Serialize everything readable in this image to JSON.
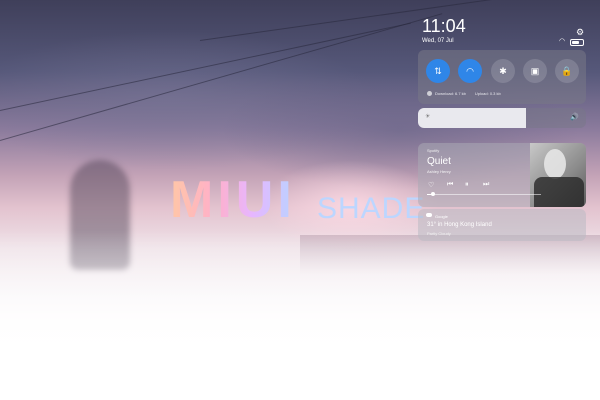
{
  "logo": {
    "primary": "MIUI",
    "secondary": "SHADE"
  },
  "status": {
    "time": "11:04",
    "date": "Wed, 07 Jul",
    "settings_icon": "gear-icon",
    "wifi_icon": "wifi-icon",
    "battery_icon": "battery-icon"
  },
  "toggles": [
    {
      "name": "data-toggle",
      "icon": "⇅",
      "on": true
    },
    {
      "name": "wifi-toggle",
      "icon": "◠",
      "on": true
    },
    {
      "name": "bluetooth-toggle",
      "icon": "✱",
      "on": false
    },
    {
      "name": "screenshot-toggle",
      "icon": "▣",
      "on": false
    },
    {
      "name": "lock-toggle",
      "icon": "🔒",
      "on": false
    }
  ],
  "network": {
    "download": "Download: 6.7 kb",
    "upload": "Upload: 0.3 kb"
  },
  "brightness": {
    "level": 0.64,
    "sun_icon": "☀",
    "volume_icon": "🔊"
  },
  "media": {
    "source": "Spotify",
    "title": "Quiet",
    "artist": "Ashley Henry",
    "controls": {
      "like": "♡",
      "prev": "⏮",
      "pause": "⏸",
      "next": "⏭"
    },
    "progress": 0.05
  },
  "weather": {
    "provider": "Google",
    "temperature": "31° in Hong Kong Island",
    "condition": "Partly Cloudy"
  },
  "colors": {
    "accent": "#2f86e8"
  }
}
